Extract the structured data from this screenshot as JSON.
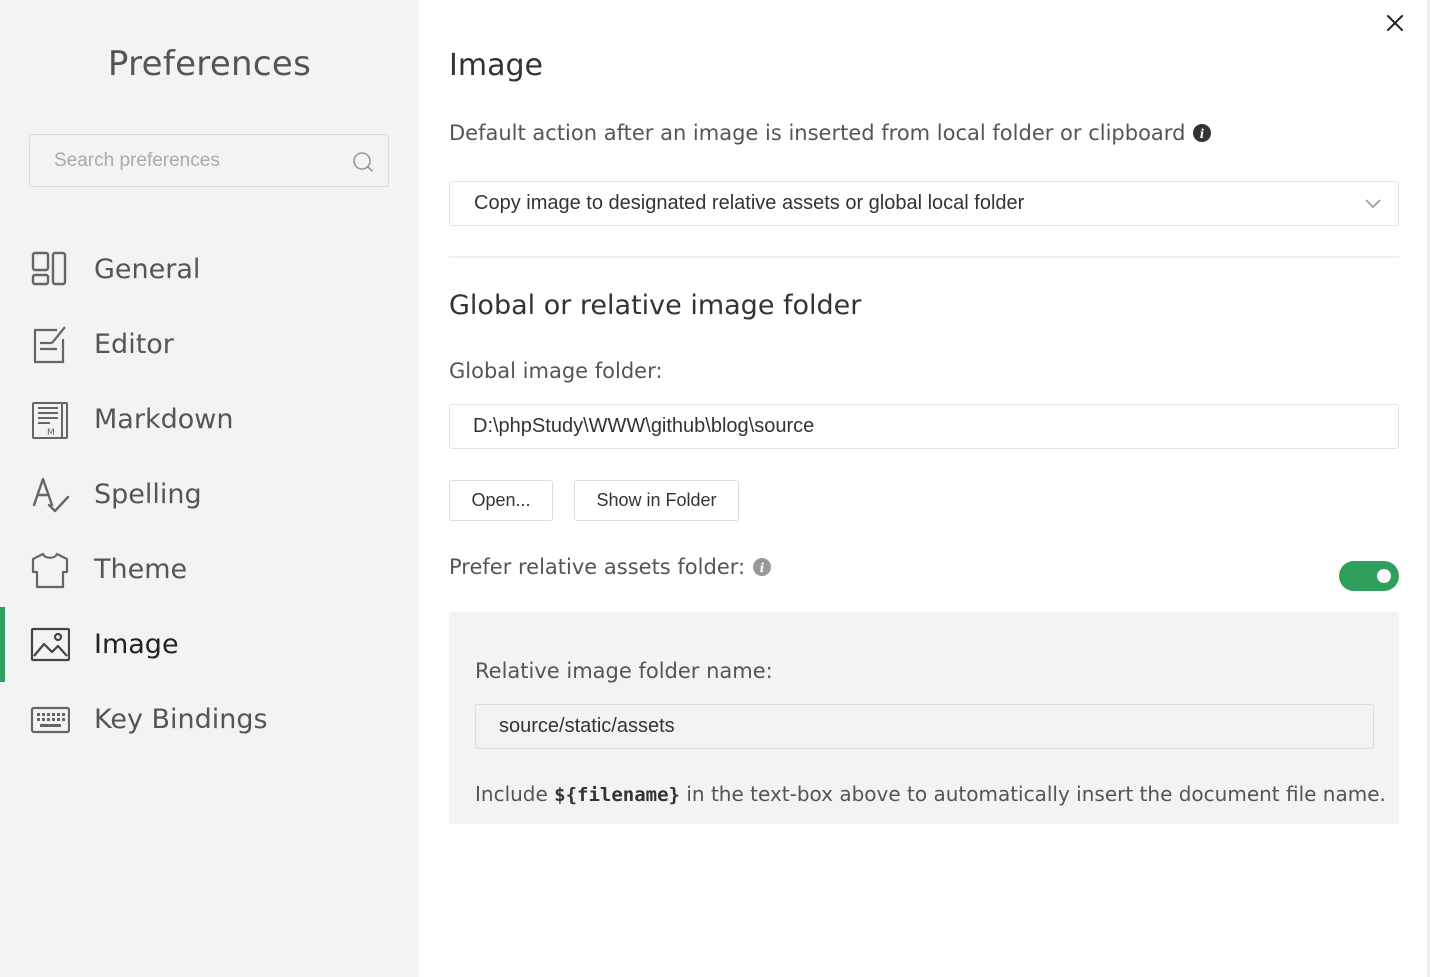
{
  "sidebar": {
    "title": "Preferences",
    "search_placeholder": "Search preferences",
    "items": [
      {
        "label": "General",
        "icon": "general-icon"
      },
      {
        "label": "Editor",
        "icon": "editor-icon"
      },
      {
        "label": "Markdown",
        "icon": "markdown-icon"
      },
      {
        "label": "Spelling",
        "icon": "spelling-icon"
      },
      {
        "label": "Theme",
        "icon": "theme-icon"
      },
      {
        "label": "Image",
        "icon": "image-icon",
        "active": true
      },
      {
        "label": "Key Bindings",
        "icon": "keyboard-icon"
      }
    ]
  },
  "main": {
    "section_title": "Image",
    "default_action_label": "Default action after an image is inserted from local folder or clipboard",
    "default_action_value": "Copy image to designated relative assets or global local folder",
    "folder_section_title": "Global or relative image folder",
    "global_folder_label": "Global image folder:",
    "global_folder_value": "D:\\phpStudy\\WWW\\github\\blog\\source",
    "open_button": "Open...",
    "show_folder_button": "Show in Folder",
    "prefer_relative_label": "Prefer relative assets folder:",
    "prefer_relative_enabled": true,
    "relative_folder_label": "Relative image folder name:",
    "relative_folder_value": "source/static/assets",
    "hint_prefix": "Include",
    "hint_code": "${filename}",
    "hint_suffix": "in the text-box above to automatically insert the document file name."
  },
  "colors": {
    "accent": "#2e9f5c",
    "sidebar_bg": "#f3f3f3"
  }
}
